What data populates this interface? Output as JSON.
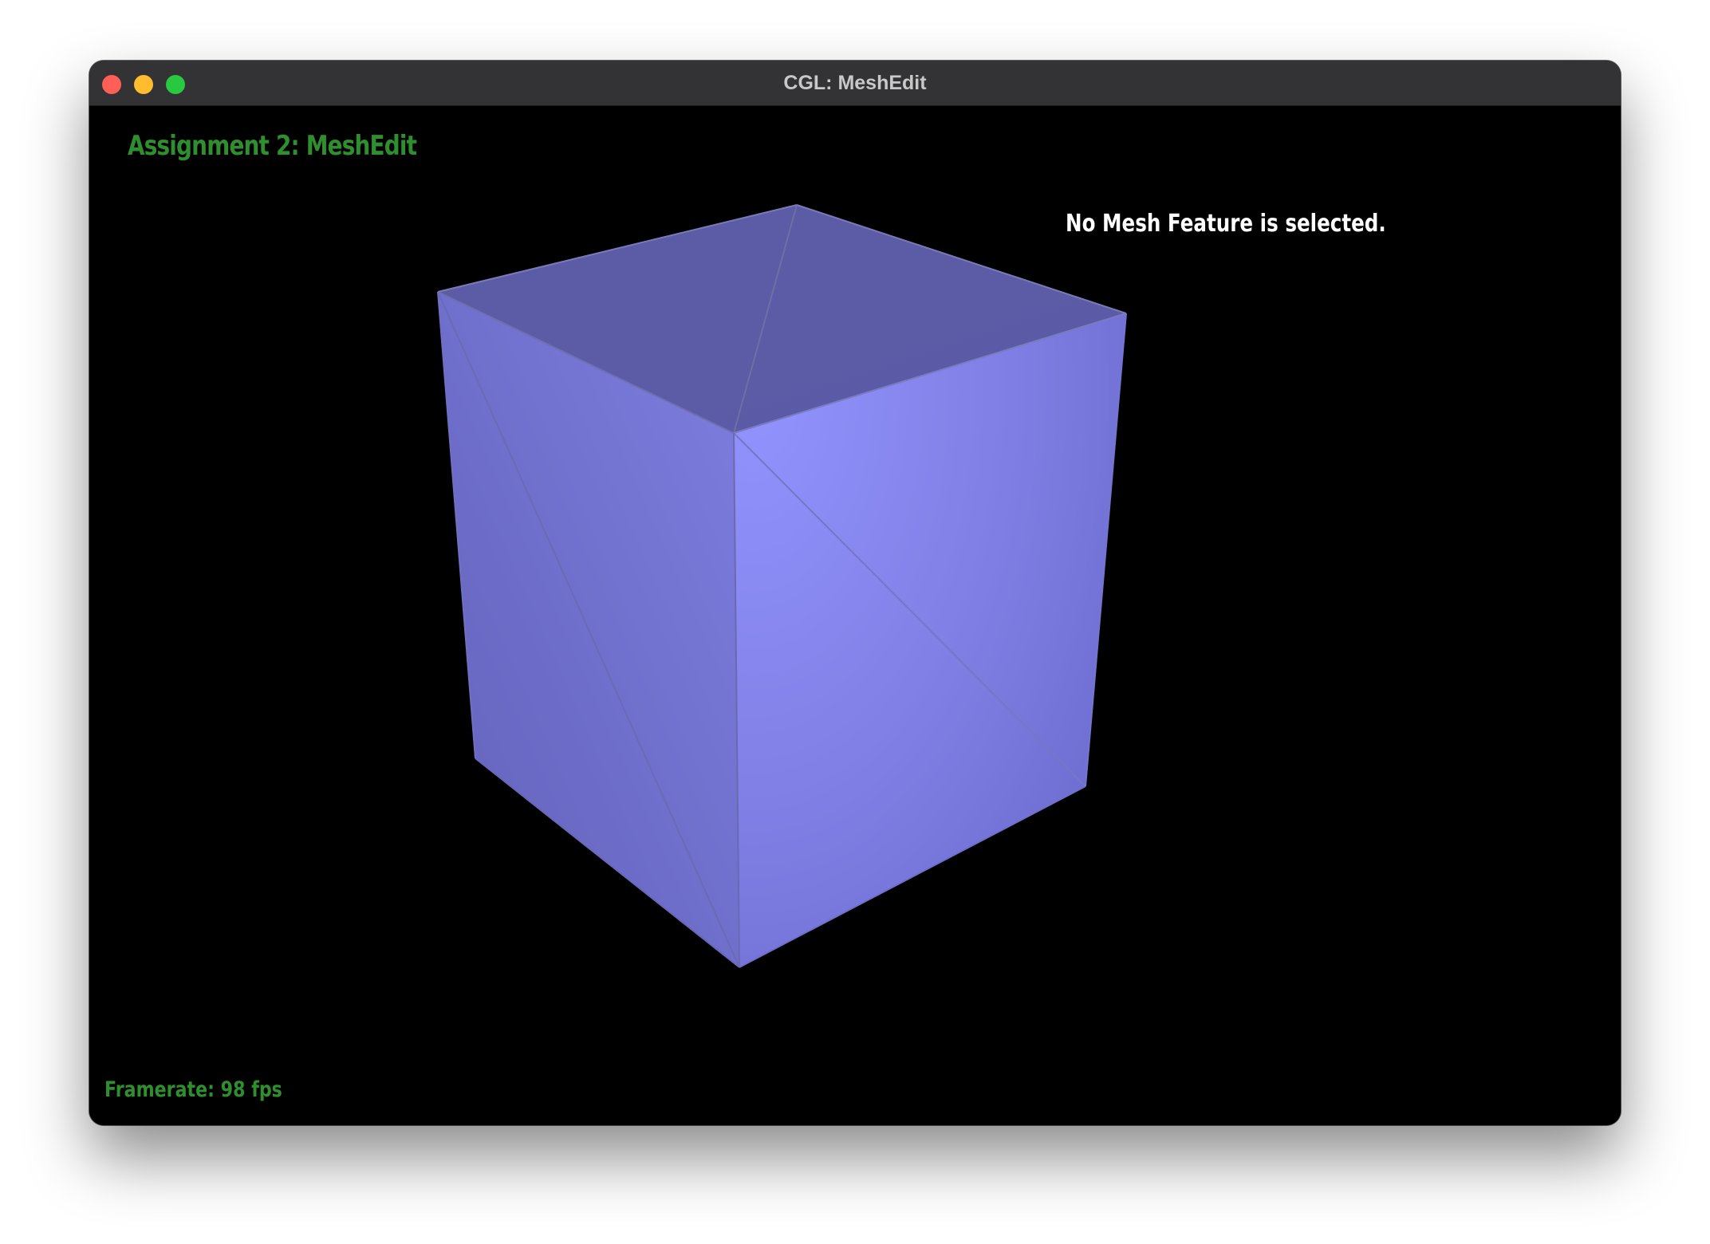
{
  "window": {
    "title": "CGL: MeshEdit",
    "controls": [
      "close",
      "minimize",
      "maximize"
    ]
  },
  "overlay": {
    "heading": "Assignment 2: MeshEdit",
    "selection_status": "No Mesh Feature is selected.",
    "framerate": "Framerate: 98 fps"
  },
  "scene": {
    "object": "cube-mesh",
    "face_color": "#8a8af0",
    "edge_color": "#777777",
    "background": "#000000"
  },
  "colors": {
    "text_accent": "#2f8f2f",
    "text_primary": "#ffffff",
    "close": "#ff5f57",
    "minimize": "#febc2e",
    "maximize": "#28c840"
  }
}
